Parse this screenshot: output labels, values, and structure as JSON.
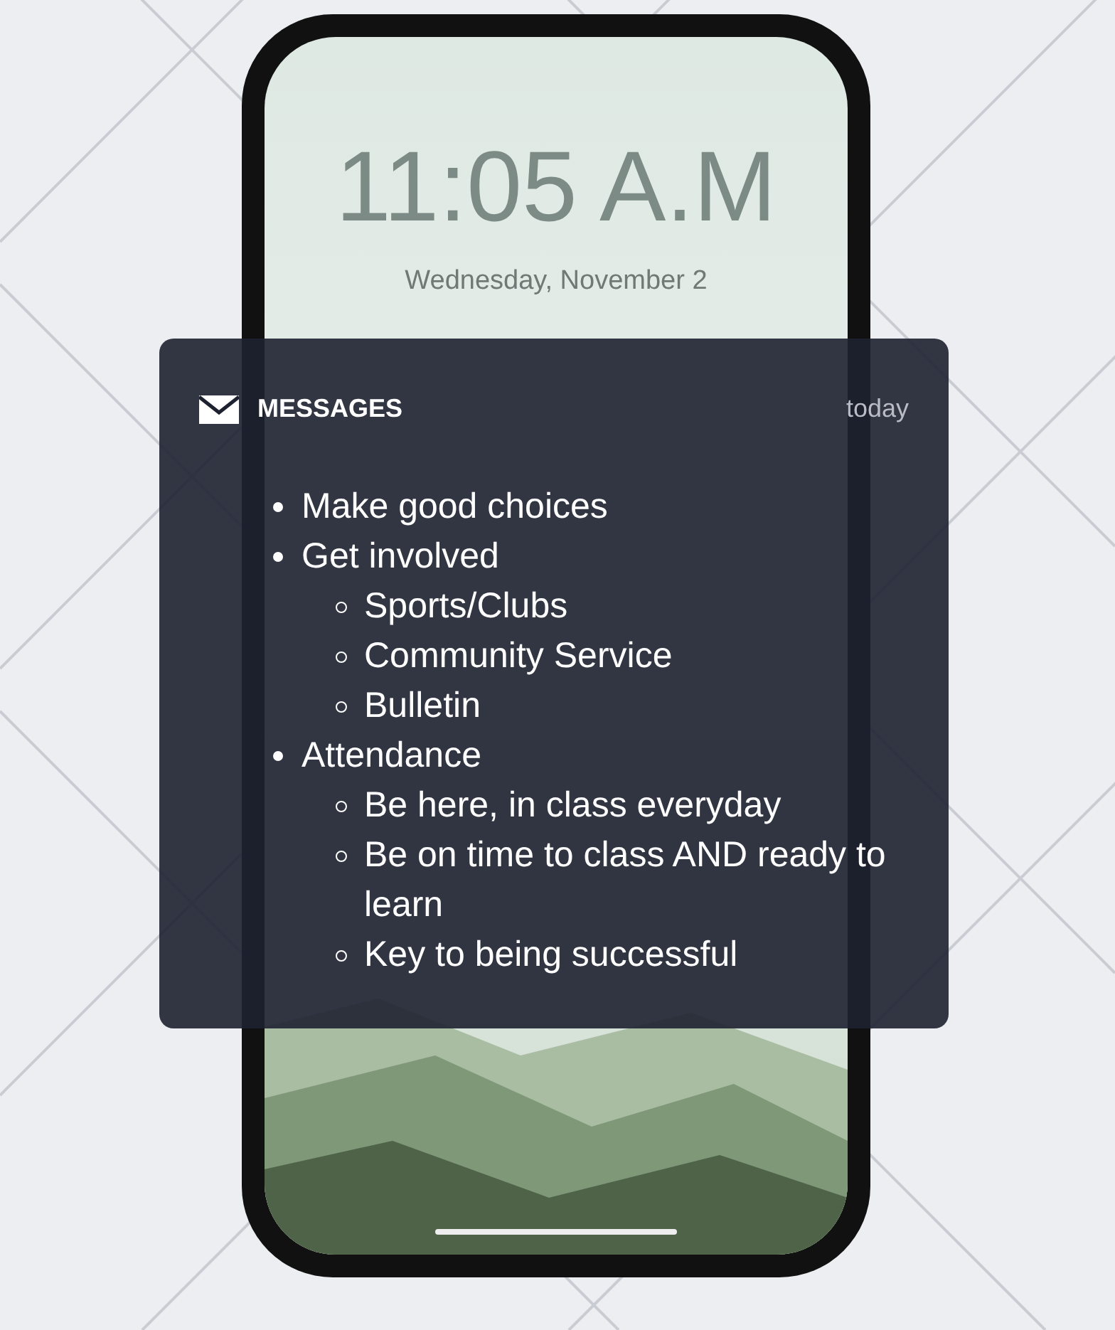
{
  "lock_screen": {
    "time": "11:05 A.M",
    "date": "Wednesday, November 2"
  },
  "notification": {
    "app": "MESSAGES",
    "time": "today",
    "items": [
      {
        "text": "Make good choices"
      },
      {
        "text": "Get involved",
        "children": [
          {
            "text": "Sports/Clubs"
          },
          {
            "text": "Community Service"
          },
          {
            "text": "Bulletin"
          }
        ]
      },
      {
        "text": "Attendance",
        "children": [
          {
            "text": "Be here, in class everyday"
          },
          {
            "text": "Be on time to class AND ready to learn"
          },
          {
            "text": "Key to being successful"
          }
        ]
      }
    ]
  }
}
